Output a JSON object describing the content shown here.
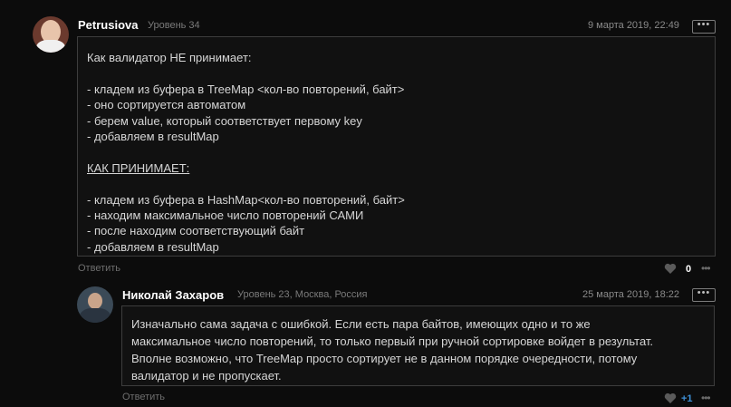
{
  "comment1": {
    "author": "Petrusiova",
    "level": "Уровень 34",
    "date": "9 марта 2019, 22:49",
    "more_label": "•••",
    "lines": [
      "Как валидатор НЕ принимает:",
      "",
      "- кладем из буфера в TreeMap <кол-во повторений, байт>",
      "- оно сортируется автоматом",
      "- берем value, который соответствует первому key",
      "- добавляем в resultMap",
      "",
      "КАК ПРИНИМАЕТ:",
      "",
      "- кладем из буфера в HashMap<кол-во повторений, байт>",
      "- находим максимальное число повторений САМИ",
      "- после находим соответствующий байт",
      "- добавляем в resultMap"
    ],
    "reply_label": "Ответить",
    "likes": "0",
    "like_color": "#ffffff"
  },
  "comment2": {
    "author": "Николай Захаров",
    "level": "Уровень 23, Москва, Россия",
    "date": "25 марта 2019, 18:22",
    "more_label": "•••",
    "lines": [
      "Изначально сама задача с ошибкой. Если есть пара байтов, имеющих одно и то же",
      "максимальное число повторений, то только первый при ручной сортировке войдет в результат.",
      "Вполне возможно, что TreeMap просто сортирует не в данном порядке очередности, потому",
      "валидатор и не пропускает."
    ],
    "reply_label": "Ответить",
    "likes": "+1",
    "like_color": "#3d8fd6"
  }
}
